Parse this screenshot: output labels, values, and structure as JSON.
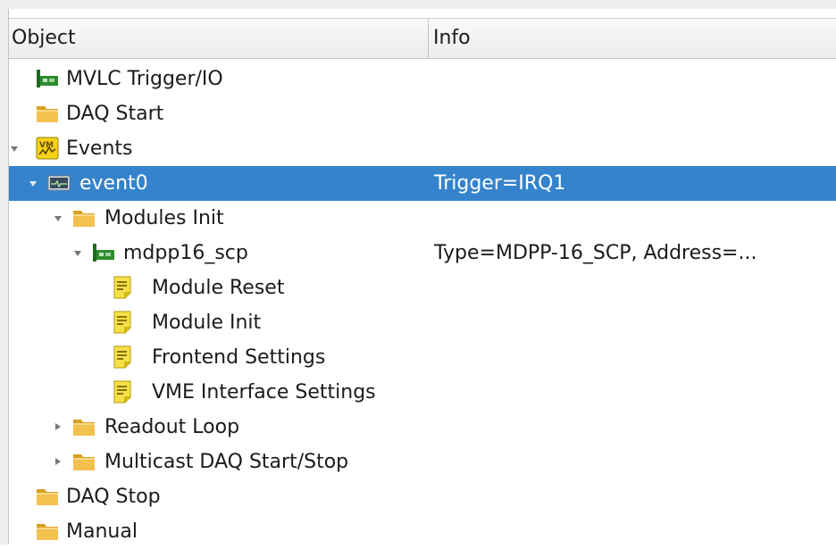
{
  "header": {
    "object": "Object",
    "info": "Info"
  },
  "rows": [
    {
      "label": "MVLC Trigger/IO",
      "info": "",
      "icon": "module-board-icon"
    },
    {
      "label": "DAQ Start",
      "info": "",
      "icon": "folder-icon"
    },
    {
      "label": "Events",
      "info": "",
      "icon": "vme-events-icon",
      "expanded": true
    },
    {
      "label": "event0",
      "info": "Trigger=IRQ1",
      "icon": "event-icon",
      "expanded": true,
      "selected": true
    },
    {
      "label": "Modules Init",
      "info": "",
      "icon": "folder-icon",
      "expanded": true
    },
    {
      "label": "mdpp16_scp",
      "info": "Type=MDPP-16_SCP, Address=...",
      "icon": "module-board-icon",
      "expanded": true
    },
    {
      "label": "Module Reset",
      "info": "",
      "icon": "script-icon"
    },
    {
      "label": "Module Init",
      "info": "",
      "icon": "script-icon"
    },
    {
      "label": "Frontend Settings",
      "info": "",
      "icon": "script-icon"
    },
    {
      "label": "VME Interface Settings",
      "info": "",
      "icon": "script-icon"
    },
    {
      "label": "Readout Loop",
      "info": "",
      "icon": "folder-icon",
      "expanded": false
    },
    {
      "label": "Multicast DAQ Start/Stop",
      "info": "",
      "icon": "folder-icon",
      "expanded": false
    },
    {
      "label": "DAQ Stop",
      "info": "",
      "icon": "folder-icon"
    },
    {
      "label": "Manual",
      "info": "",
      "icon": "folder-icon"
    }
  ],
  "colors": {
    "selection": "#3583cc",
    "folder": "#f2c14e",
    "script": "#f5e04a",
    "module": "#2e8b2e"
  }
}
